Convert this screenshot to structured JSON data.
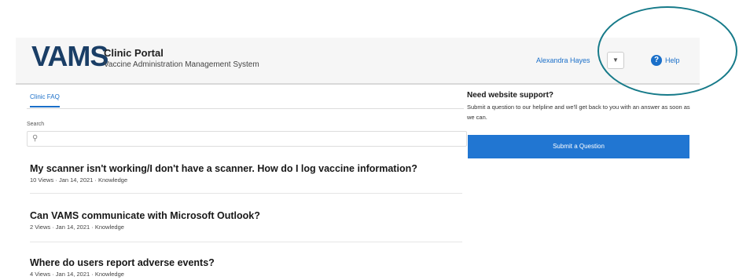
{
  "header": {
    "logo_text": "VAMS",
    "app_title": "Clinic Portal",
    "app_subtitle": "Vaccine Administration Management System",
    "user_name": "Alexandra Hayes",
    "dropdown_icon": "chevron-down-icon",
    "help_icon": "help-icon",
    "help_label": "Help"
  },
  "tabs": [
    {
      "label": "Clinic FAQ",
      "active": true
    }
  ],
  "search": {
    "label": "Search",
    "value": "",
    "placeholder": ""
  },
  "articles": [
    {
      "title": "My scanner isn't working/I don't have a scanner. How do I log vaccine information?",
      "meta": "10 Views  ·  Jan 14, 2021  ·  Knowledge"
    },
    {
      "title": "Can VAMS communicate with Microsoft Outlook?",
      "meta": "2 Views  ·  Jan 14, 2021  ·  Knowledge"
    },
    {
      "title": "Where do users report adverse events?",
      "meta": "4 Views  ·  Jan 14, 2021  ·  Knowledge"
    }
  ],
  "support": {
    "title": "Need website support?",
    "text": "Submit a question to our helpline and we'll get back to you with an answer as soon as we can.",
    "button_label": "Submit a Question"
  },
  "colors": {
    "accent": "#2176d2",
    "logo": "#1a3e66",
    "highlight_circle": "#167a89"
  }
}
